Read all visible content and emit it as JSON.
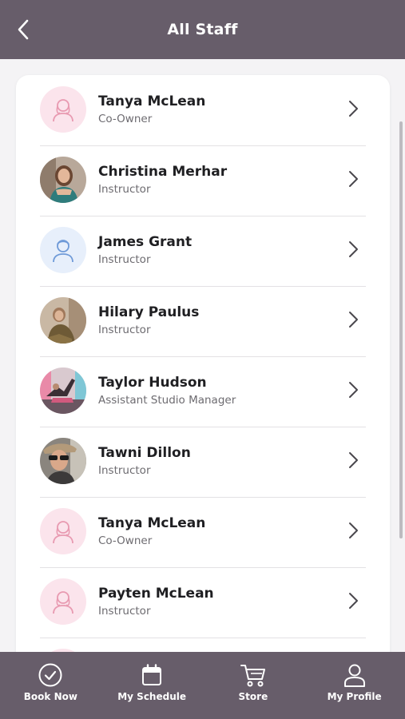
{
  "header": {
    "title": "All Staff"
  },
  "staff": [
    {
      "name": "Tanya McLean",
      "role": "Co-Owner",
      "avatar": "female-placeholder-icon"
    },
    {
      "name": "Christina Merhar",
      "role": "Instructor",
      "avatar": "photo"
    },
    {
      "name": "James Grant",
      "role": "Instructor",
      "avatar": "male-placeholder-icon"
    },
    {
      "name": "Hilary Paulus",
      "role": "Instructor",
      "avatar": "photo"
    },
    {
      "name": "Taylor Hudson",
      "role": "Assistant Studio Manager",
      "avatar": "photo"
    },
    {
      "name": "Tawni Dillon",
      "role": "Instructor",
      "avatar": "photo"
    },
    {
      "name": "Tanya McLean",
      "role": "Co-Owner",
      "avatar": "female-placeholder-icon"
    },
    {
      "name": "Payten McLean",
      "role": "Instructor",
      "avatar": "female-placeholder-icon"
    }
  ],
  "tabs": [
    {
      "label": "Book Now",
      "icon": "check-circle-icon"
    },
    {
      "label": "My Schedule",
      "icon": "calendar-icon"
    },
    {
      "label": "Store",
      "icon": "cart-icon"
    },
    {
      "label": "My Profile",
      "icon": "person-icon"
    }
  ],
  "colors": {
    "header": "#675d6a",
    "pink_avatar_bg": "#fbe4ec",
    "pink_icon": "#e89ab1",
    "blue_avatar_bg": "#e7effb",
    "blue_icon": "#6f9ad8"
  }
}
